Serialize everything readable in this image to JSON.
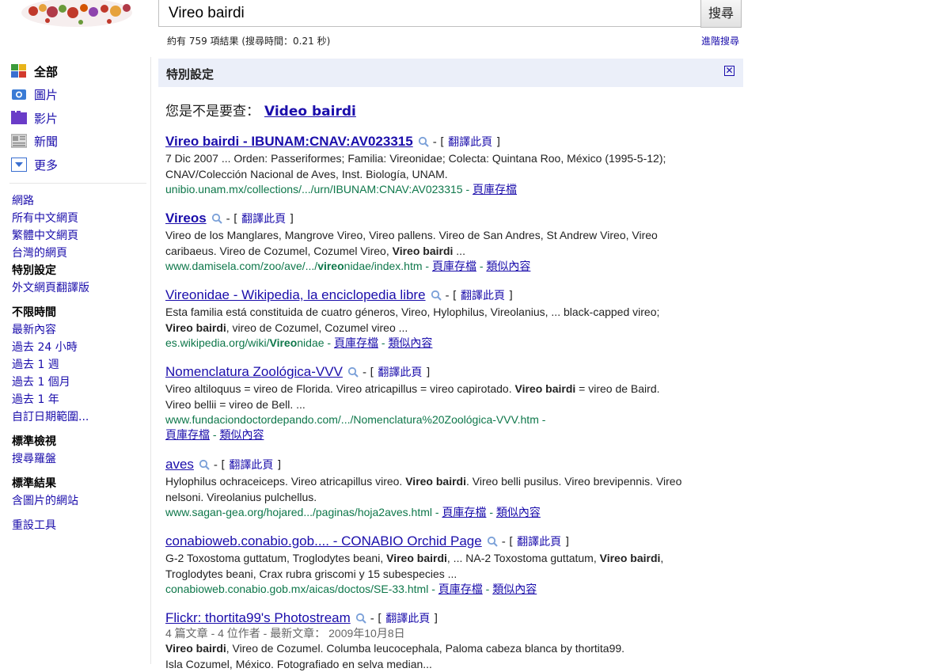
{
  "search": {
    "query": "Vireo bairdi",
    "button": "搜尋"
  },
  "stats": {
    "text": "約有 759 項結果 (搜尋時間：0.21 秒)",
    "advanced": "進階搜尋"
  },
  "nav": {
    "types": [
      {
        "label": "全部",
        "icon": "all-icon"
      },
      {
        "label": "圖片",
        "icon": "camera-icon"
      },
      {
        "label": "影片",
        "icon": "film-icon"
      },
      {
        "label": "新聞",
        "icon": "newspaper-icon"
      },
      {
        "label": "更多",
        "icon": "chevron-down-icon"
      }
    ],
    "scope": [
      "網路",
      "所有中文網頁",
      "繁體中文網頁",
      "台灣的網頁",
      "特別設定",
      "外文網頁翻譯版"
    ],
    "time": [
      "不限時間",
      "最新內容",
      "過去 24 小時",
      "過去 1 週",
      "過去 1 個月",
      "過去 1 年",
      "自訂日期範圍..."
    ],
    "view": [
      "標準檢視",
      "搜尋羅盤"
    ],
    "results": [
      "標準結果",
      "含圖片的網站"
    ],
    "reset": "重設工具"
  },
  "bar": {
    "title": "特別設定",
    "close": "✕"
  },
  "dym": {
    "prefix": "您是不是要查：",
    "b": "Video",
    "rest": "bairdi"
  },
  "translate_label": "翻譯此頁",
  "cache_label": "頁庫存檔",
  "similar_label": "類似內容",
  "results": [
    {
      "title": "Vireo bairdi - IBUNAM:CNAV:AV023315",
      "snippet": "7 Dic 2007 ... Orden: Passeriformes; Familia: Vireonidae; Colecta: Quintana Roo, México (1995-5-12); CNAV/Colección Nacional de Aves, Inst. Biología, UNAM.",
      "url": "unibio.unam.mx/collections/.../urn/IBUNAM:CNAV:AV023315"
    },
    {
      "title": "Vireos",
      "snippet_a": "Vireo de los Manglares, Mangrove Vireo, Vireo pallens. Vireo de San Andres, St Andrew Vireo, Vireo caribaeus. Vireo de Cozumel, Cozumel Vireo, ",
      "snippet_b": "Vireo bairdi",
      "snippet_c": " ...",
      "url_a": "www.damisela.com/zoo/ave/.../",
      "url_b": "vireo",
      "url_c": "nidae/index.htm"
    },
    {
      "title": "Vireonidae - Wikipedia, la enciclopedia libre",
      "snippet_a": "Esta familia está constituida de cuatro géneros, Vireo, Hylophilus, Vireolanius, ... black-capped vireo; ",
      "snippet_b": "Vireo bairdi",
      "snippet_c": ", vireo de Cozumel, Cozumel vireo ...",
      "url_a": "es.wikipedia.org/wiki/",
      "url_b": "Vireo",
      "url_c": "nidae"
    },
    {
      "title": "Nomenclatura Zoológica-VVV",
      "snippet_a": "Vireo altiloquus = vireo de Florida. Vireo atricapillus = vireo capirotado. ",
      "snippet_b": "Vireo bairdi",
      "snippet_c": " = vireo de Baird. Vireo bellii = vireo de Bell. ...",
      "url": "www.fundaciondoctordepando.com/.../Nomenclatura%20Zoológica-VVV.htm"
    },
    {
      "title": "aves",
      "snippet_a": "Hylophilus ochraceiceps. Vireo atricapillus vireo. ",
      "snippet_b": "Vireo bairdi",
      "snippet_c": ". Vireo belli pusilus. Vireo brevipennis. Vireo nelsoni. Vireolanius pulchellus.",
      "url": "www.sagan-gea.org/hojared.../paginas/hoja2aves.html"
    },
    {
      "title": "conabioweb.conabio.gob.... - CONABIO Orchid Page",
      "snippet_a": "G-2 Toxostoma guttatum, Troglodytes beani, ",
      "snippet_b": "Vireo bairdi",
      "snippet_c": ", ... NA-2 Toxostoma guttatum, ",
      "snippet_d": "Vireo bairdi",
      "snippet_e": ", Troglodytes beani, Crax rubra griscomi y 15 subespecies ...",
      "url": "conabioweb.conabio.gob.mx/aicas/doctos/SE-33.html"
    },
    {
      "title": "Flickr: thortita99's Photostream",
      "meta": "4 篇文章 - 4 位作者 - 最新文章： 2009年10月8日",
      "snippet_b": "Vireo bairdi",
      "snippet_c": ", Vireo de Cozumel. Columba leucocephala, Paloma cabeza blanca by thortita99.",
      "snippet_d": "Isla Cozumel, México. Fotografiado en selva median..."
    }
  ],
  "colors": {
    "link": "#1a0dab",
    "url": "#0e774a",
    "bar": "#ebeff9"
  }
}
